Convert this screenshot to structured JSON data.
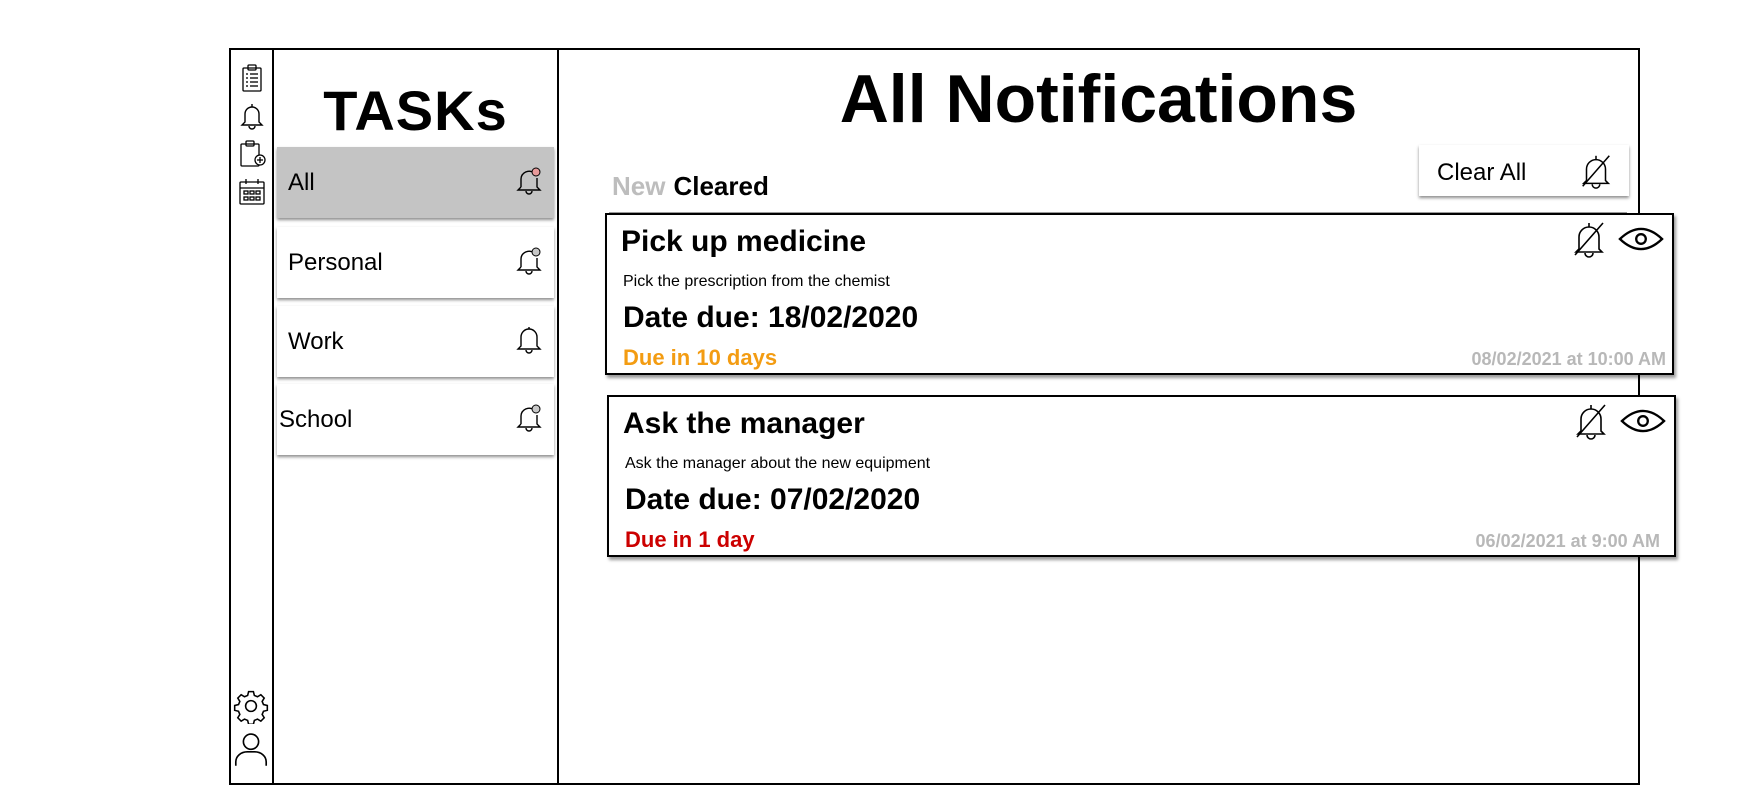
{
  "sidebar": {
    "title": "TASKs",
    "items": [
      {
        "label": "All",
        "bell": "bell-notification-icon",
        "active": true
      },
      {
        "label": "Personal",
        "bell": "bell-notification-icon",
        "active": false
      },
      {
        "label": "Work",
        "bell": "bell-icon",
        "active": false
      },
      {
        "label": "School",
        "bell": "bell-notification-icon",
        "active": false
      }
    ]
  },
  "rail": {
    "icons": [
      "clipboard-list-icon",
      "bell-icon",
      "add-task-icon",
      "calendar-icon",
      "settings-gear-icon",
      "user-profile-icon"
    ]
  },
  "main": {
    "title": "All Notifications",
    "tabs": {
      "new": "New",
      "cleared": "Cleared"
    },
    "clear_all_label": "Clear All",
    "notifications": [
      {
        "title": "Pick up medicine",
        "description": "Pick the prescription from the chemist",
        "date_due": "Date due: 18/02/2020",
        "status": "Due in 10 days",
        "status_color": "#f39c12",
        "timestamp": "08/02/2021 at 10:00 AM"
      },
      {
        "title": "Ask the manager",
        "description": "Ask the manager about the new equipment",
        "date_due": "Date due: 07/02/2020",
        "status": "Due in 1 day",
        "status_color": "#cc0000",
        "timestamp": "06/02/2021 at 9:00 AM"
      }
    ]
  },
  "colors": {
    "active_item_bg": "#c4c4c4",
    "muted_text": "#b8b8b8",
    "badge": "#e89a9a"
  }
}
